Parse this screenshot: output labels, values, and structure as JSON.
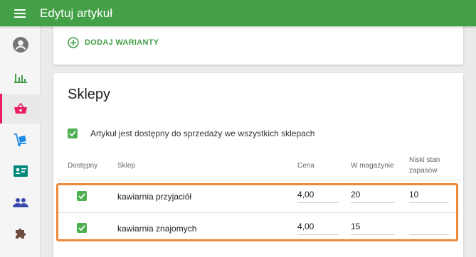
{
  "appbar": {
    "title": "Edytuj artykuł"
  },
  "sidebar": {
    "items": [
      {
        "name": "profile",
        "icon": "account-circle-icon"
      },
      {
        "name": "reports",
        "icon": "bar-chart-icon"
      },
      {
        "name": "products",
        "icon": "basket-icon",
        "active": true
      },
      {
        "name": "deliveries",
        "icon": "hand-truck-icon"
      },
      {
        "name": "customers",
        "icon": "contact-card-icon"
      },
      {
        "name": "employees",
        "icon": "people-icon"
      },
      {
        "name": "addons",
        "icon": "puzzle-icon"
      }
    ]
  },
  "variants": {
    "add_label": "DODAJ WARIANTY"
  },
  "shops": {
    "title": "Sklepy",
    "all_shops_label": "Artykuł jest dostępny do sprzedaży we wszystkich sklepach",
    "all_shops_checked": true,
    "columns": {
      "available": "Dostępny",
      "shop": "Sklep",
      "price": "Cena",
      "stock": "W magazynie",
      "low_stock_1": "Niski stan",
      "low_stock_2": "zapasów"
    },
    "rows": [
      {
        "available": true,
        "shop": "kawiarnia przyjaciół",
        "price": "4,00",
        "stock": "20",
        "low_stock": "10"
      },
      {
        "available": true,
        "shop": "kawiarnia znajomych",
        "price": "4,00",
        "stock": "15",
        "low_stock": ""
      }
    ]
  },
  "colors": {
    "primary": "#43a047",
    "accent": "#e91e63",
    "highlight": "#f0883a"
  }
}
